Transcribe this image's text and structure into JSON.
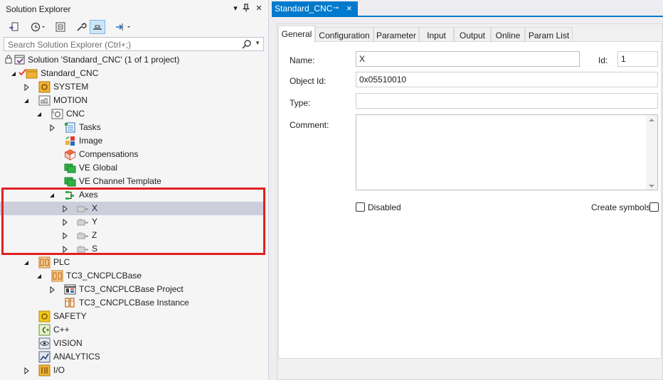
{
  "solution_explorer": {
    "title": "Solution Explorer",
    "title_controls": [
      "▾",
      "⊥",
      "✕"
    ],
    "search_placeholder": "Search Solution Explorer (Ctrl+;)",
    "toolbar_icons": [
      "sync-icon",
      "history-icon",
      "collapse-all-icon",
      "properties-wrench-icon",
      "preview-icon",
      "pending-changes-icon"
    ],
    "tree": [
      {
        "label": "Solution 'Standard_CNC' (1 of 1 project)",
        "icon": "solution-icon",
        "level": 0
      },
      {
        "label": "Standard_CNC",
        "icon": "project-icon",
        "level": 0
      },
      {
        "label": "SYSTEM",
        "icon": "system-icon",
        "level": 1
      },
      {
        "label": "MOTION",
        "icon": "motion-icon",
        "level": 1
      },
      {
        "label": "CNC",
        "icon": "cnc-icon",
        "level": 2
      },
      {
        "label": "Tasks",
        "icon": "tasks-icon",
        "level": 3
      },
      {
        "label": "Image",
        "icon": "image-icon",
        "level": 3
      },
      {
        "label": "Compensations",
        "icon": "compensations-icon",
        "level": 3
      },
      {
        "label": "VE Global",
        "icon": "ve-global-icon",
        "level": 3
      },
      {
        "label": "VE Channel Template",
        "icon": "ve-channel-template-icon",
        "level": 3
      },
      {
        "label": "Axes",
        "icon": "axes-icon",
        "level": 3
      },
      {
        "label": "X",
        "icon": "axis-icon",
        "level": 4
      },
      {
        "label": "Y",
        "icon": "axis-icon",
        "level": 4
      },
      {
        "label": "Z",
        "icon": "axis-icon",
        "level": 4
      },
      {
        "label": "S",
        "icon": "axis-icon",
        "level": 4
      },
      {
        "label": "PLC",
        "icon": "plc-icon",
        "level": 1
      },
      {
        "label": "TC3_CNCPLCBase",
        "icon": "plc-project-icon",
        "level": 2
      },
      {
        "label": "TC3_CNCPLCBase Project",
        "icon": "plc-subproject-icon",
        "level": 3
      },
      {
        "label": "TC3_CNCPLCBase Instance",
        "icon": "plc-instance-icon",
        "level": 3
      },
      {
        "label": "SAFETY",
        "icon": "safety-icon",
        "level": 1
      },
      {
        "label": "C++",
        "icon": "cpp-icon",
        "level": 1
      },
      {
        "label": "VISION",
        "icon": "vision-icon",
        "level": 1
      },
      {
        "label": "ANALYTICS",
        "icon": "analytics-icon",
        "level": 1
      },
      {
        "label": "I/O",
        "icon": "io-icon",
        "level": 1
      }
    ]
  },
  "document": {
    "tab_title": "Standard_CNC",
    "tab_pin": "⊸",
    "tab_close": "×",
    "tabs": [
      "General",
      "Configuration",
      "Parameter",
      "Input",
      "Output",
      "Online",
      "Param List"
    ],
    "active_tab": "General",
    "form": {
      "name_label": "Name:",
      "name_value": "X",
      "id_label": "Id:",
      "id_value": "1",
      "object_id_label": "Object Id:",
      "object_id_value": "0x05510010",
      "type_label": "Type:",
      "type_value": "",
      "comment_label": "Comment:",
      "comment_value": "",
      "disabled_label": "Disabled",
      "disabled_checked": false,
      "create_symbols_label": "Create symbols",
      "create_symbols_checked": false
    }
  },
  "colors": {
    "accent": "#007acc",
    "selection": "#cccedb",
    "highlight_border": "#e0201f"
  }
}
